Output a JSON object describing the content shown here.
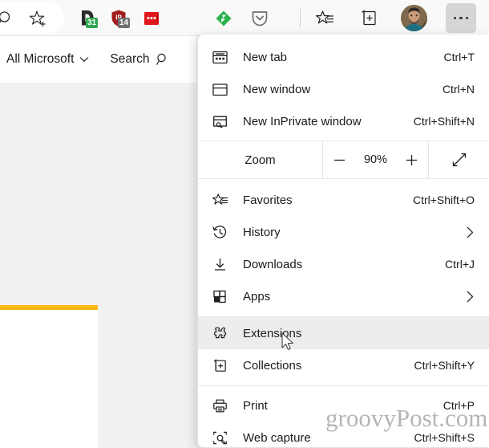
{
  "toolbar": {
    "omnibox": {
      "search_icon": "search-icon",
      "favorite_icon": "add-favorite-icon"
    },
    "extensions": [
      {
        "name": "todoist-extension",
        "badge": "31",
        "badge_color": "#2fa84f",
        "icon": "todoist-icon"
      },
      {
        "name": "adblock-extension",
        "badge": "14",
        "badge_color": "#717171",
        "icon": "shield-icon"
      },
      {
        "name": "red-dots-extension",
        "badge": "",
        "badge_color": "#e0181c",
        "icon": "red-square-icon"
      },
      {
        "name": "feedly-extension",
        "badge": "",
        "badge_color": "#2bb24c",
        "icon": "feedly-icon"
      },
      {
        "name": "pocket-extension",
        "badge": "",
        "badge_color": "#767676",
        "icon": "pocket-icon"
      }
    ],
    "favorites_icon_label": "favorites-icon",
    "collections_icon_label": "collections-icon",
    "avatar_label": "profile-avatar",
    "more_label": "settings-and-more-button"
  },
  "site_bar": {
    "all_microsoft": "All Microsoft",
    "chevron": "chevron-down-icon",
    "search": "Search",
    "search_icon": "search-icon"
  },
  "menu": {
    "groups": [
      {
        "items": [
          {
            "icon": "new-tab-icon",
            "label": "New tab",
            "accel": "Ctrl+T",
            "chevron": false,
            "highlighted": false
          },
          {
            "icon": "new-window-icon",
            "label": "New window",
            "accel": "Ctrl+N",
            "chevron": false,
            "highlighted": false
          },
          {
            "icon": "inprivate-icon",
            "label": "New InPrivate window",
            "accel": "Ctrl+Shift+N",
            "chevron": false,
            "highlighted": false
          }
        ]
      }
    ],
    "zoom": {
      "label": "Zoom",
      "minus": "minus-icon",
      "value": "90%",
      "plus": "plus-icon",
      "fullscreen": "fullscreen-icon"
    },
    "group2": [
      {
        "icon": "favorites-icon",
        "label": "Favorites",
        "accel": "Ctrl+Shift+O",
        "chevron": false,
        "highlighted": false
      },
      {
        "icon": "history-icon",
        "label": "History",
        "accel": "",
        "chevron": true,
        "highlighted": false
      },
      {
        "icon": "downloads-icon",
        "label": "Downloads",
        "accel": "Ctrl+J",
        "chevron": false,
        "highlighted": false
      },
      {
        "icon": "apps-icon",
        "label": "Apps",
        "accel": "",
        "chevron": true,
        "highlighted": false
      }
    ],
    "group3": [
      {
        "icon": "extensions-icon",
        "label": "Extensions",
        "accel": "",
        "chevron": false,
        "highlighted": true
      },
      {
        "icon": "collections-icon",
        "label": "Collections",
        "accel": "Ctrl+Shift+Y",
        "chevron": false,
        "highlighted": false
      }
    ],
    "group4": [
      {
        "icon": "print-icon",
        "label": "Print",
        "accel": "Ctrl+P",
        "chevron": false,
        "highlighted": false
      },
      {
        "icon": "web-capture-icon",
        "label": "Web capture",
        "accel": "Ctrl+Shift+S",
        "chevron": false,
        "highlighted": false
      }
    ]
  },
  "watermark": {
    "text": "groovyPost.com"
  },
  "colors": {
    "accent_bar": "#fdb913",
    "highlight": "#ededed",
    "page_bg": "#f1f1f1"
  }
}
